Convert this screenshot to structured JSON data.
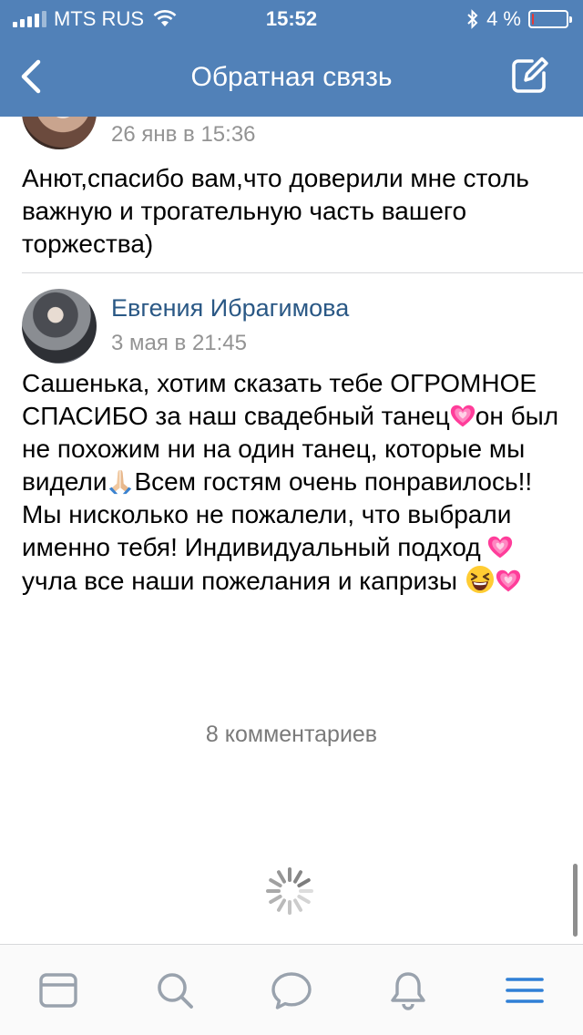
{
  "status_bar": {
    "carrier": "MTS RUS",
    "time": "15:52",
    "battery_percent": "4 %",
    "battery_level": 0.04
  },
  "nav": {
    "title": "Обратная связь"
  },
  "comments": [
    {
      "author": "",
      "date": "26 янв в 15:36",
      "text": "Анют,спасибо вам,что доверили мне столь важную и трогательную часть вашего торжества)"
    },
    {
      "author": "Евгения Ибрагимова",
      "date": "3 мая в 21:45",
      "text_parts": [
        "Сашенька, хотим сказать тебе ОГРОМНОЕ СПАСИБО за наш свадебный танец",
        "он был не похожим ни на один танец, которые мы видели",
        "Всем гостям очень понравилось!! Мы нисколько не пожалели, что выбрали именно тебя! Индивидуальный подход ",
        " учла все наши пожелания и капризы "
      ]
    }
  ],
  "comments_count": "8 комментариев",
  "icons": {
    "back": "chevron-left-icon",
    "compose": "compose-icon",
    "heart": "sparkling-heart-icon",
    "pray": "pray-icon",
    "laugh": "laughing-face-icon",
    "spinner": "spinner-icon",
    "tabs": [
      "news-icon",
      "search-icon",
      "messages-icon",
      "notifications-icon",
      "menu-icon"
    ]
  },
  "colors": {
    "header": "#5181b8",
    "link": "#2a5885",
    "secondary": "#939393",
    "accent": "#2f7fd6"
  }
}
